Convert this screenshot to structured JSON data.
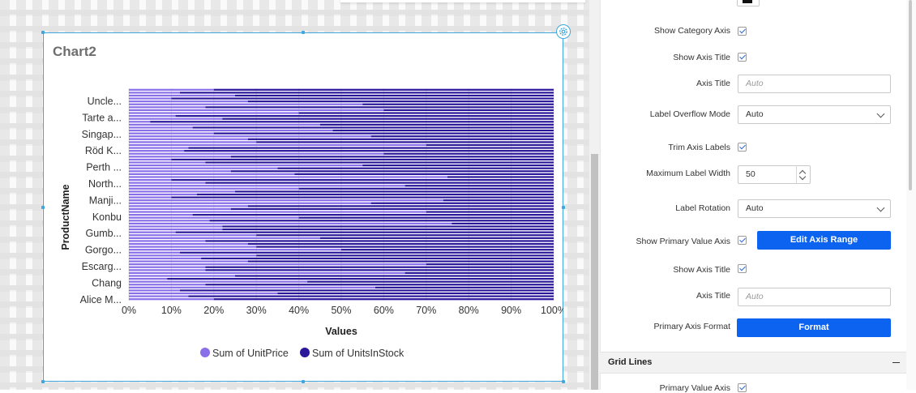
{
  "chart": {
    "title": "Chart2"
  },
  "panel": {
    "show_category_axis": "Show Category Axis",
    "show_axis_title_1": "Show Axis Title",
    "axis_title_1": "Axis Title",
    "axis_title_1_placeholder": "Auto",
    "label_overflow_mode": "Label Overflow Mode",
    "label_overflow_value": "Auto",
    "trim_axis_labels": "Trim Axis Labels",
    "maximum_label_width": "Maximum Label Width",
    "maximum_label_width_value": "50",
    "label_rotation": "Label Rotation",
    "label_rotation_value": "Auto",
    "show_primary_value_axis": "Show Primary Value Axis",
    "edit_axis_range": "Edit Axis Range",
    "show_axis_title_2": "Show Axis Title",
    "axis_title_2": "Axis Title",
    "axis_title_2_placeholder": "Auto",
    "primary_axis_format": "Primary Axis Format",
    "format_button": "Format",
    "grid_lines_section": "Grid Lines",
    "primary_value_axis": "Primary Value Axis"
  },
  "colors": {
    "series_unitprice": "#8a70e8",
    "series_unitsinstock": "#2a1799",
    "accent_button": "#0b63f0",
    "selection_border": "#3fa7dd"
  },
  "chart_data": {
    "type": "bar",
    "orientation": "horizontal",
    "stacking": "100%",
    "title": "Chart2",
    "xlabel": "Values",
    "ylabel": "ProductName",
    "xlim": [
      0,
      100
    ],
    "x_ticks": [
      "0%",
      "10%",
      "20%",
      "30%",
      "40%",
      "50%",
      "60%",
      "70%",
      "80%",
      "90%",
      "100%"
    ],
    "categories": [
      "Uncle...",
      "Tarte a...",
      "Singap...",
      "Röd K...",
      "Perth ...",
      "North...",
      "Manji...",
      "Konbu",
      "Gumb...",
      "Gorgo...",
      "Escarg...",
      "Chang",
      "Alice M..."
    ],
    "series": [
      {
        "name": "Sum of UnitPrice",
        "values_pct": [
          20,
          12,
          25,
          10,
          28,
          55,
          18,
          60,
          40,
          11,
          22,
          5,
          45,
          15,
          48,
          20,
          57,
          28,
          30,
          70,
          14,
          13,
          60,
          24,
          10,
          18,
          55,
          35,
          24,
          39,
          75,
          10,
          18,
          65,
          40,
          25,
          16,
          10,
          74,
          57,
          28,
          24,
          70,
          15,
          40,
          19,
          76,
          22,
          22,
          11,
          30,
          45,
          18,
          28,
          30,
          50,
          12,
          30,
          17,
          28,
          70,
          18,
          18,
          65,
          25,
          9,
          42,
          18,
          58,
          12,
          35,
          14,
          20
        ]
      },
      {
        "name": "Sum of UnitsInStock",
        "values_pct": [
          80,
          88,
          75,
          90,
          72,
          45,
          82,
          40,
          60,
          89,
          78,
          95,
          55,
          85,
          52,
          80,
          43,
          72,
          70,
          30,
          86,
          87,
          40,
          76,
          90,
          82,
          45,
          65,
          76,
          61,
          25,
          90,
          82,
          35,
          60,
          75,
          84,
          90,
          26,
          43,
          72,
          76,
          30,
          85,
          60,
          81,
          24,
          78,
          78,
          89,
          70,
          55,
          82,
          72,
          70,
          50,
          88,
          70,
          83,
          72,
          30,
          82,
          82,
          35,
          75,
          91,
          58,
          82,
          42,
          88,
          65,
          86,
          80
        ]
      }
    ],
    "legend": "bottom",
    "grid": true
  }
}
